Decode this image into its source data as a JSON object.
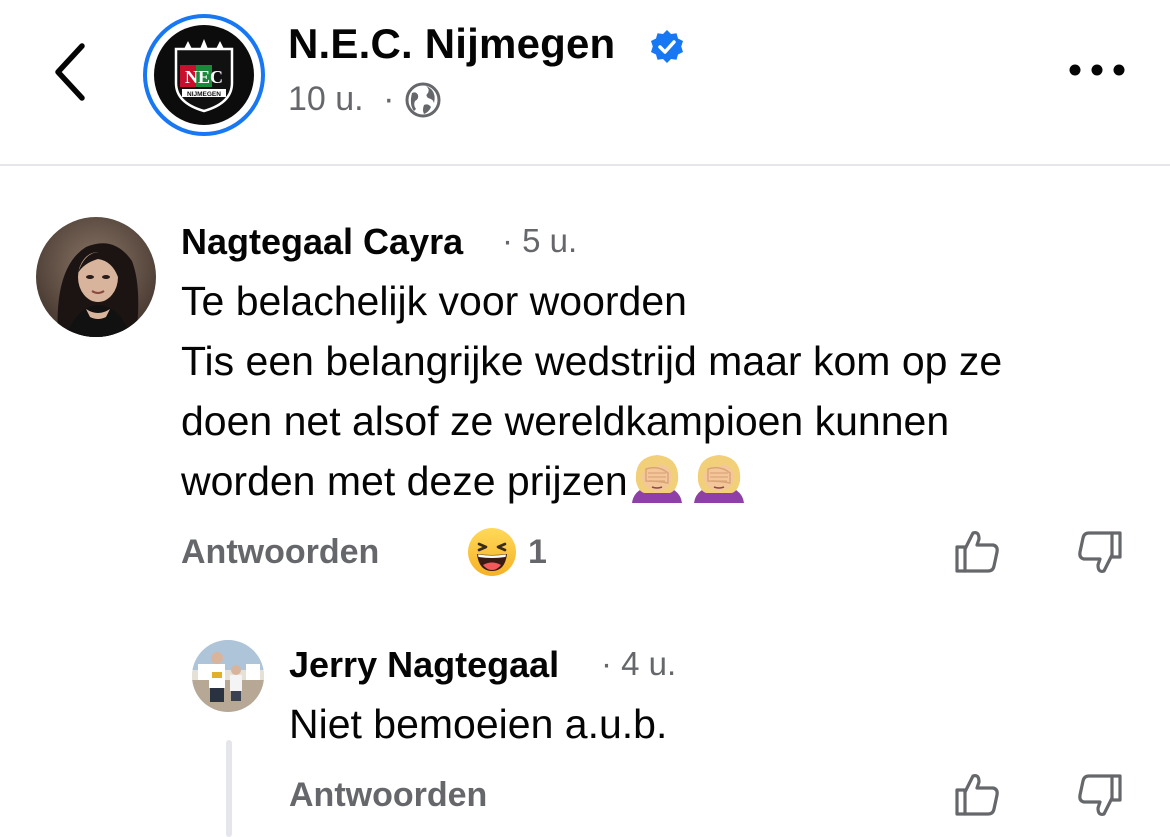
{
  "header": {
    "page_name": "N.E.C. Nijmegen",
    "post_time": "10 u.",
    "separator": "·",
    "logo_text": "NEC",
    "logo_subtext": "NIJMEGEN",
    "icons": {
      "back": "chevron-left-icon",
      "verified": "verified-badge-icon",
      "audience": "globe-icon",
      "more": "more-options-icon"
    },
    "colors": {
      "verified": "#1877f2",
      "ring": "#1877f2"
    }
  },
  "comments": [
    {
      "author": "Nagtegaal Cayra",
      "time": "· 5 u.",
      "text_lines": [
        "Te belachelijk voor woorden",
        "Tis een belangrijke wedstrijd maar kom op ze",
        "doen net alsof ze wereldkampioen kunnen",
        "worden met deze prijzen"
      ],
      "trailing_emoji": "face-palm-emoji x2",
      "reply_label": "Antwoorden",
      "reaction": {
        "icon": "haha-reaction-icon",
        "count": "1"
      },
      "upvote_icon": "thumbs-up-icon",
      "downvote_icon": "thumbs-down-icon"
    },
    {
      "author": "Jerry Nagtegaal",
      "time": "· 4 u.",
      "text_lines": [
        "Niet bemoeien a.u.b."
      ],
      "reply_label": "Antwoorden",
      "upvote_icon": "thumbs-up-icon",
      "downvote_icon": "thumbs-down-icon"
    }
  ]
}
